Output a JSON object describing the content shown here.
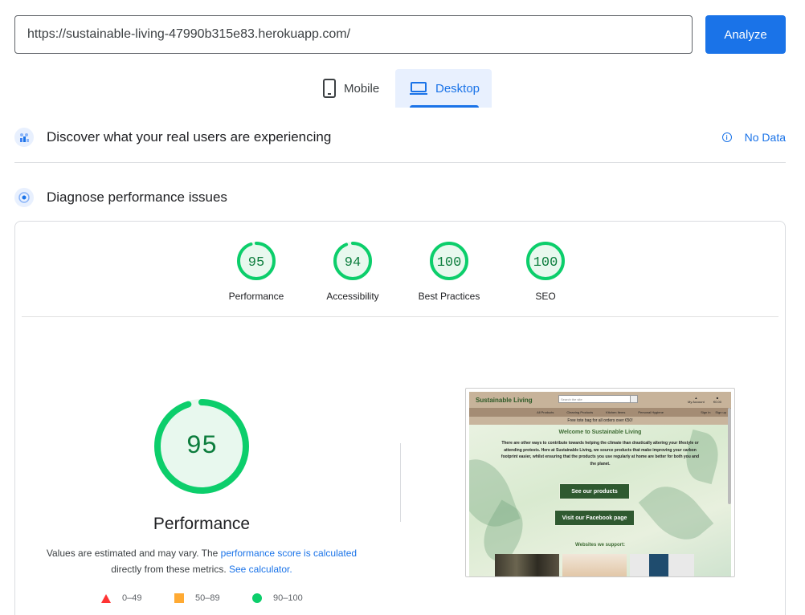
{
  "url_bar": {
    "value": "https://sustainable-living-47990b315e83.herokuapp.com/",
    "analyze_label": "Analyze"
  },
  "device_tabs": {
    "mobile_label": "Mobile",
    "desktop_label": "Desktop",
    "selected": "Desktop"
  },
  "field_data": {
    "title": "Discover what your real users are experiencing",
    "status_label": "No Data"
  },
  "lab_data": {
    "title": "Diagnose performance issues"
  },
  "categories": [
    {
      "score": "95",
      "label": "Performance",
      "value": 95
    },
    {
      "score": "94",
      "label": "Accessibility",
      "value": 94
    },
    {
      "score": "100",
      "label": "Best Practices",
      "value": 100
    },
    {
      "score": "100",
      "label": "SEO",
      "value": 100
    }
  ],
  "performance": {
    "score": "95",
    "value": 95,
    "title": "Performance",
    "note_prefix": "Values are estimated and may vary. The ",
    "note_link": "performance score is calculated",
    "note_middle": "directly from these metrics.",
    "calculator_link": "See calculator."
  },
  "legend": [
    {
      "range": "0–49",
      "color": "#ff3333",
      "icon": "triangle-icon"
    },
    {
      "range": "50–89",
      "color": "#ffaa33",
      "icon": "square-icon"
    },
    {
      "range": "90–100",
      "color": "#0cce6b",
      "icon": "circle-icon"
    }
  ],
  "colors": {
    "accent": "#1a73e8",
    "pass": "#0cce6b",
    "pass_text": "#0c7d3d",
    "pass_bg": "#e8f8ee"
  },
  "screenshot": {
    "brand": "Sustainable Living",
    "search_placeholder": "Search the site",
    "account": "My Account",
    "cart": "€0.00",
    "nav": [
      "All Products",
      "Cleaning Products",
      "Kitchen Items",
      "Personal Hygiene"
    ],
    "nav_right": [
      "Sign in",
      "Sign up"
    ],
    "banner": "Free tote bag for all orders over €50!",
    "welcome": "Welcome to Sustainable Living",
    "paragraph": "There are other ways to contribute towards helping the climate than drastically altering your lifestyle or attending protests. Here at Sustainable Living, we source products that make improving your carbon footprint easier, whilst ensuring that the products you use regularly at home are better for both you and the planet.",
    "products_button": "See our products",
    "facebook_button": "Visit our Facebook page",
    "support_heading": "Websites we support:"
  }
}
